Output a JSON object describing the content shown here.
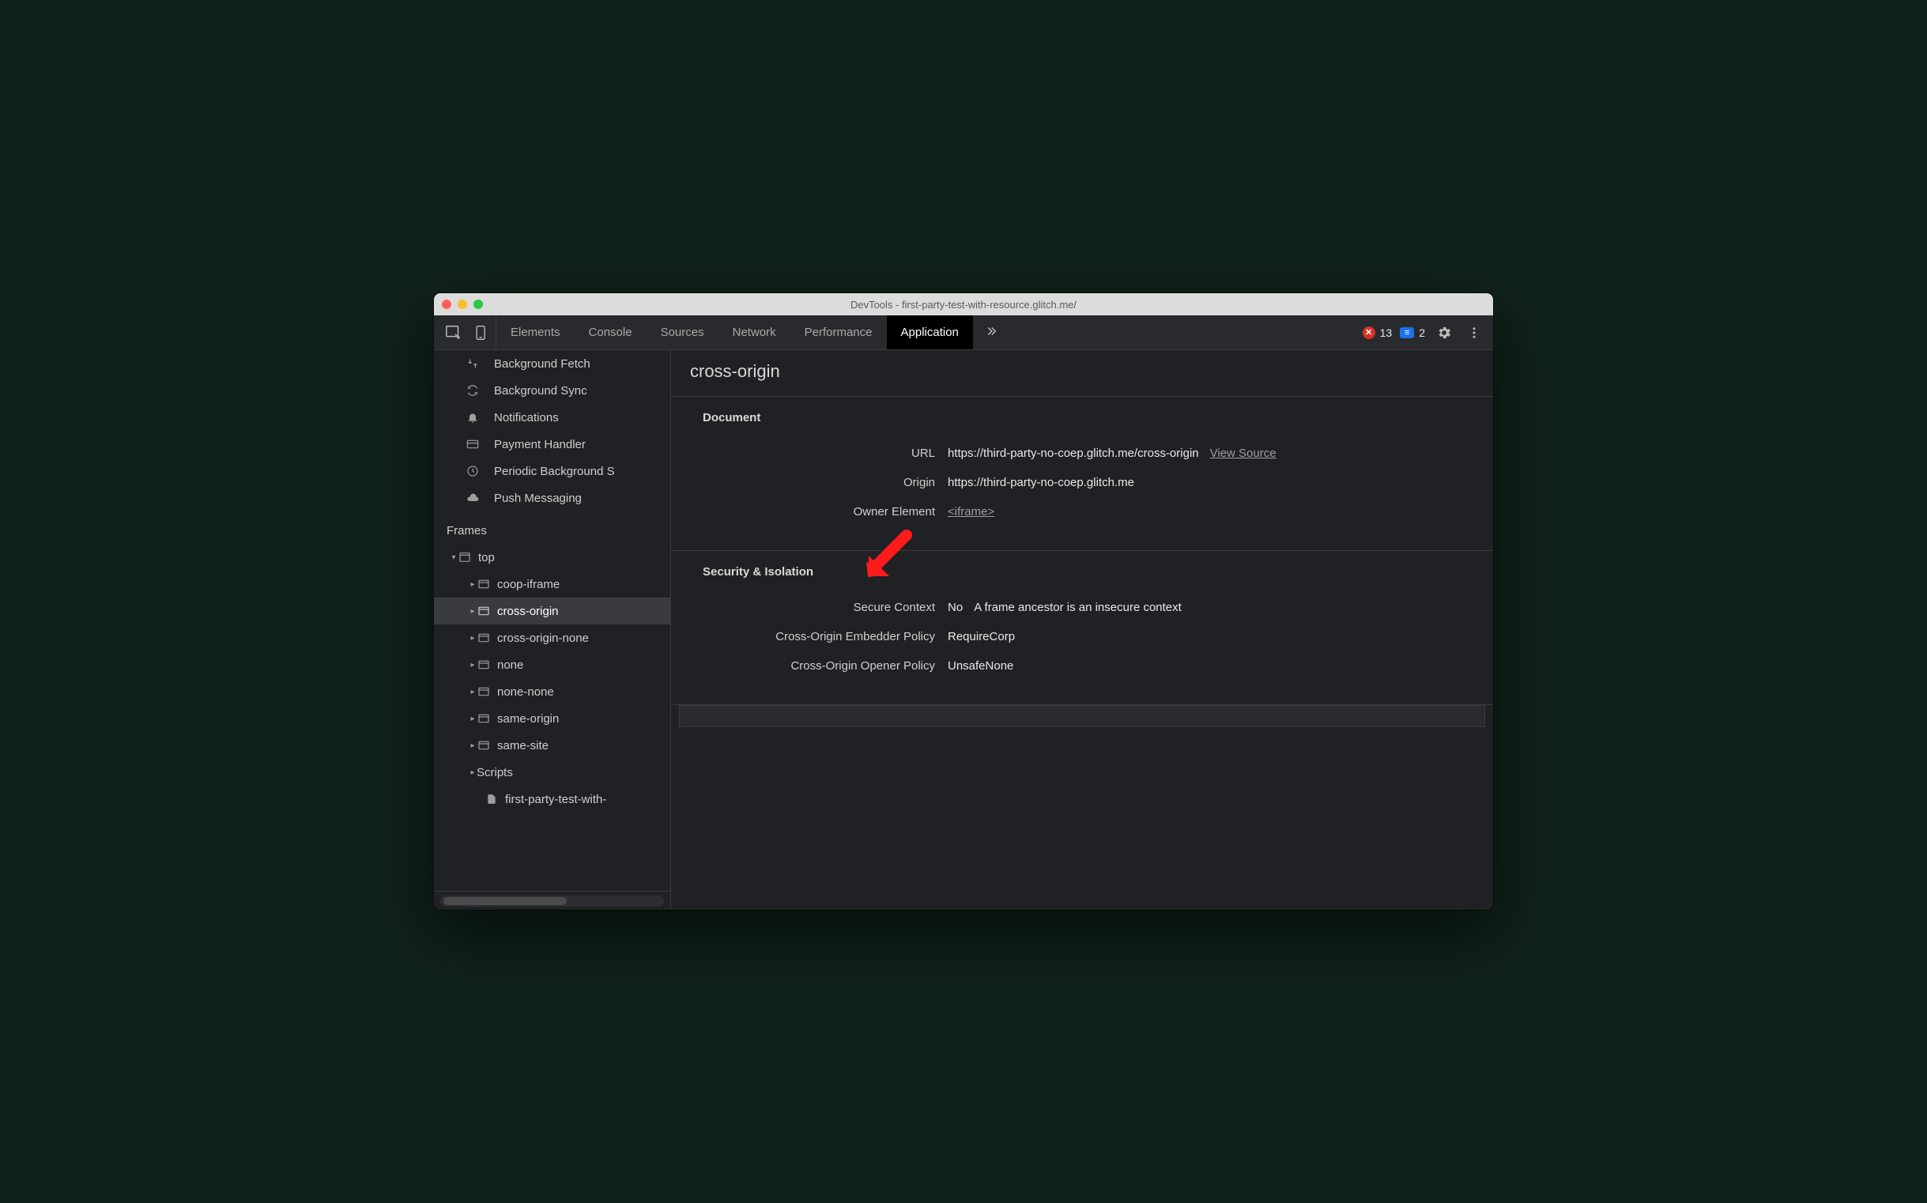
{
  "window": {
    "title": "DevTools - first-party-test-with-resource.glitch.me/"
  },
  "toolbar": {
    "tabs": [
      "Elements",
      "Console",
      "Sources",
      "Network",
      "Performance",
      "Application"
    ],
    "active_tab": "Application",
    "errors_count": "13",
    "messages_count": "2"
  },
  "sidebar": {
    "items": [
      {
        "label": "Background Fetch",
        "icon": "bg-fetch-icon"
      },
      {
        "label": "Background Sync",
        "icon": "bg-sync-icon"
      },
      {
        "label": "Notifications",
        "icon": "bell-icon"
      },
      {
        "label": "Payment Handler",
        "icon": "card-icon"
      },
      {
        "label": "Periodic Background S",
        "icon": "clock-icon"
      },
      {
        "label": "Push Messaging",
        "icon": "cloud-icon"
      }
    ],
    "frames_heading": "Frames",
    "tree": {
      "root": {
        "label": "top"
      },
      "children": [
        {
          "label": "coop-iframe"
        },
        {
          "label": "cross-origin",
          "selected": true
        },
        {
          "label": "cross-origin-none"
        },
        {
          "label": "none"
        },
        {
          "label": "none-none"
        },
        {
          "label": "same-origin"
        },
        {
          "label": "same-site"
        },
        {
          "label": "Scripts",
          "scripts": true
        },
        {
          "label": "first-party-test-with-",
          "leaf": true
        }
      ]
    }
  },
  "main": {
    "title": "cross-origin",
    "document": {
      "heading": "Document",
      "url_label": "URL",
      "url_value": "https://third-party-no-coep.glitch.me/cross-origin",
      "view_source": "View Source",
      "origin_label": "Origin",
      "origin_value": "https://third-party-no-coep.glitch.me",
      "owner_label": "Owner Element",
      "owner_value": "<iframe>"
    },
    "security": {
      "heading": "Security & Isolation",
      "secure_context_label": "Secure Context",
      "secure_context_value": "No",
      "secure_context_note": "A frame ancestor is an insecure context",
      "coep_label": "Cross-Origin Embedder Policy",
      "coep_value": "RequireCorp",
      "coop_label": "Cross-Origin Opener Policy",
      "coop_value": "UnsafeNone"
    }
  }
}
